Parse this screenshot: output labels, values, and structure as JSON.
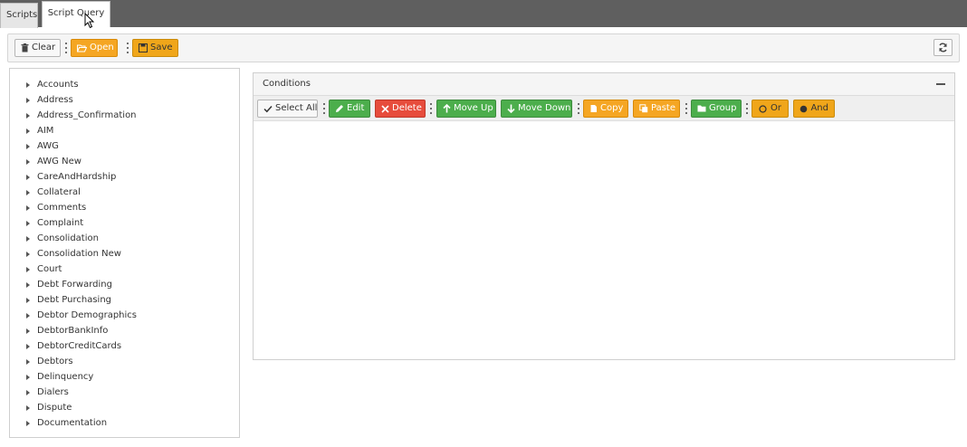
{
  "tabs": [
    {
      "label": "Scripts"
    },
    {
      "label": "Script Query"
    }
  ],
  "toolbar": {
    "clear_label": "Clear",
    "open_label": "Open",
    "save_label": "Save"
  },
  "tree": {
    "items": [
      "Accounts",
      "Address",
      "Address_Confirmation",
      "AIM",
      "AWG",
      "AWG New",
      "CareAndHardship",
      "Collateral",
      "Comments",
      "Complaint",
      "Consolidation",
      "Consolidation New",
      "Court",
      "Debt Forwarding",
      "Debt Purchasing",
      "Debtor Demographics",
      "DebtorBankInfo",
      "DebtorCreditCards",
      "Debtors",
      "Delinquency",
      "Dialers",
      "Dispute",
      "Documentation"
    ]
  },
  "conditions": {
    "title": "Conditions",
    "select_all_label": "Select All",
    "edit_label": "Edit",
    "delete_label": "Delete",
    "move_up_label": "Move Up",
    "move_down_label": "Move Down",
    "copy_label": "Copy",
    "paste_label": "Paste",
    "group_label": "Group",
    "or_label": "Or",
    "and_label": "And"
  },
  "colors": {
    "tabbar": "#5f5f5f",
    "orange": "#f5a623",
    "green": "#4cae4c",
    "red": "#e74c3c"
  }
}
